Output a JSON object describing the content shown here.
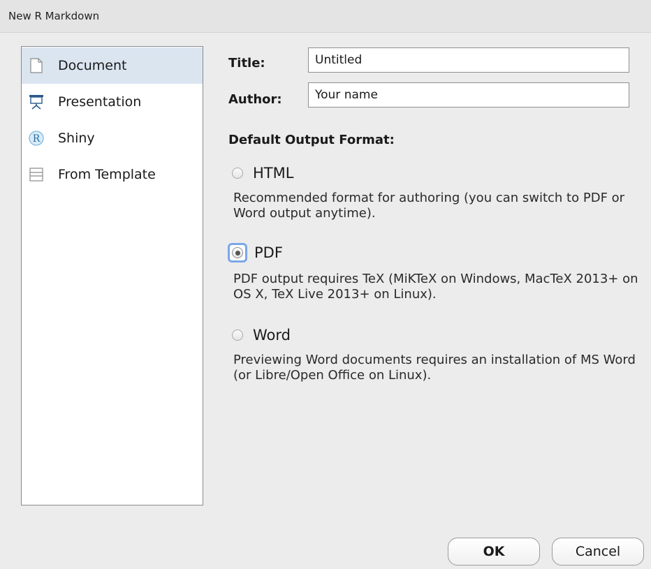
{
  "window": {
    "title": "New R Markdown"
  },
  "sidebar": {
    "items": [
      {
        "label": "Document",
        "icon": "document-icon",
        "selected": true
      },
      {
        "label": "Presentation",
        "icon": "presentation-icon",
        "selected": false
      },
      {
        "label": "Shiny",
        "icon": "shiny-r-icon",
        "selected": false
      },
      {
        "label": "From Template",
        "icon": "template-icon",
        "selected": false
      }
    ]
  },
  "form": {
    "title_label": "Title:",
    "title_value": "Untitled",
    "author_label": "Author:",
    "author_value": "Your name"
  },
  "output": {
    "section_title": "Default Output Format:",
    "options": [
      {
        "label": "HTML",
        "checked": false,
        "description": "Recommended format for authoring (you can switch to PDF or Word output anytime)."
      },
      {
        "label": "PDF",
        "checked": true,
        "description": "PDF output requires TeX (MiKTeX on Windows, MacTeX 2013+ on OS X, TeX Live 2013+ on Linux)."
      },
      {
        "label": "Word",
        "checked": false,
        "description": "Previewing Word documents requires an installation of MS Word (or Libre/Open Office on Linux)."
      }
    ]
  },
  "buttons": {
    "ok": "OK",
    "cancel": "Cancel"
  },
  "colors": {
    "selection": "#dae5f0",
    "focus_ring": "#7aa7e8",
    "dialog_bg": "#ececec"
  }
}
